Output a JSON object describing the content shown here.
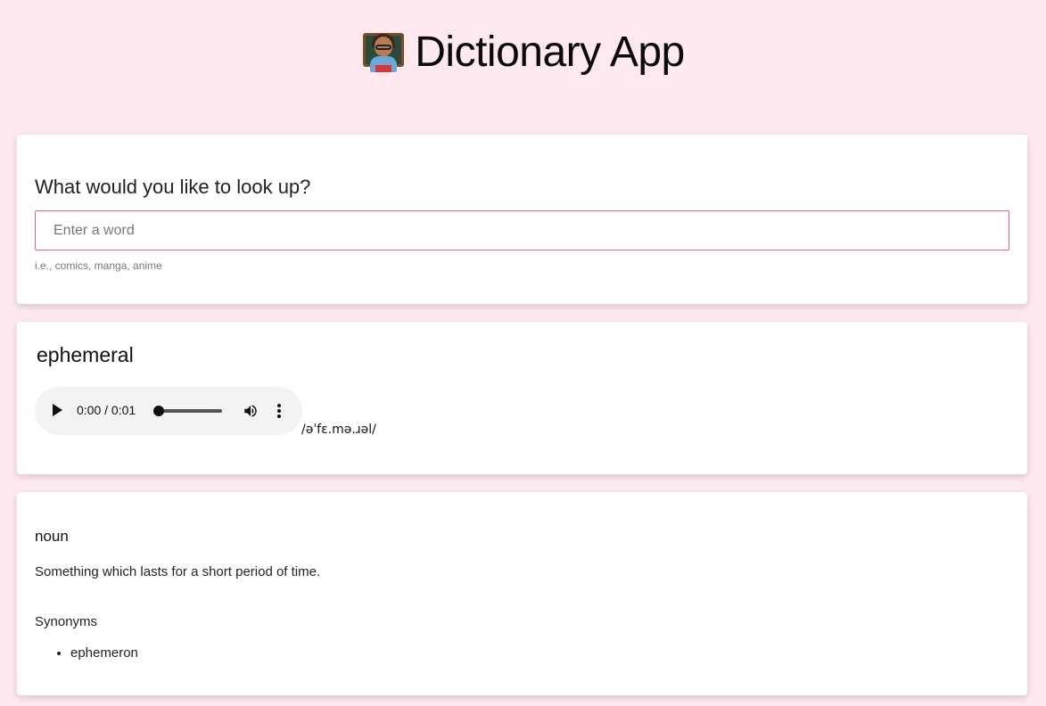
{
  "header": {
    "icon": "teacher-emoji-icon",
    "title": "Dictionary App"
  },
  "search": {
    "label": "What would you like to look up?",
    "value": "",
    "placeholder": "Enter a word",
    "hint": "i.e., comics, manga, anime",
    "border_color": "#d6619b"
  },
  "word": {
    "text": "ephemeral",
    "phonetic": "/əˈfɛ.mə.ɹəl/",
    "audio": {
      "time": "0:00 / 0:01",
      "progress": 0,
      "play_icon": "play-icon",
      "volume_icon": "volume-icon",
      "menu_icon": "more-vertical-icon"
    }
  },
  "meaning": {
    "part_of_speech": "noun",
    "definition": "Something which lasts for a short period of time.",
    "synonyms_label": "Synonyms",
    "synonyms": [
      "ephemeron"
    ]
  },
  "colors": {
    "background": "#fde9ee",
    "card": "#ffffff",
    "accent": "#d6619b"
  }
}
